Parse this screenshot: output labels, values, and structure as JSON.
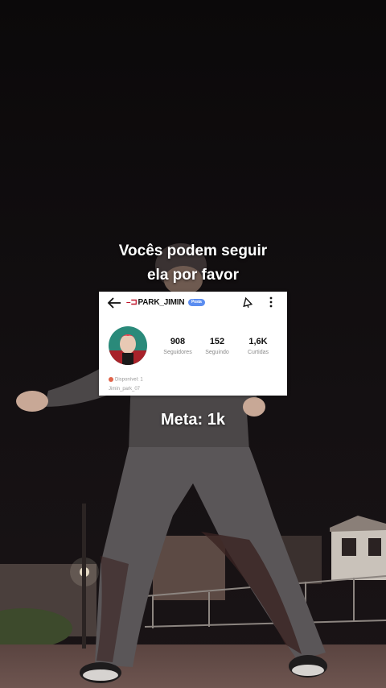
{
  "caption": {
    "line1": "Vocês podem seguir",
    "line2": "ela por favor",
    "goal": "Meta: 1k"
  },
  "profile_card": {
    "username_deco": "–⊐",
    "username": "PARK_JIMIN",
    "badge": "Posta",
    "stats": [
      {
        "value": "908",
        "label": "Seguidores"
      },
      {
        "value": "152",
        "label": "Seguindo"
      },
      {
        "value": "1,6K",
        "label": "Curtidas"
      }
    ],
    "bio_line1": "Disponível: 1",
    "bio_line2": "Jimin_park_07"
  },
  "icons": {
    "back": "arrow-left-icon",
    "notify": "bell-icon",
    "more": "more-vertical-icon"
  },
  "colors": {
    "accent": "#c0152b",
    "badge": "#5b8df0",
    "caption": "#ffffff"
  }
}
